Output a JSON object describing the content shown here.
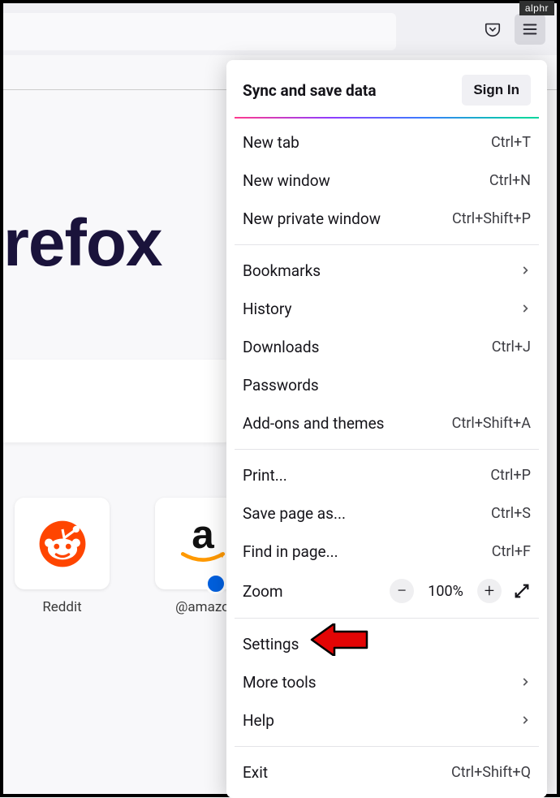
{
  "watermark": "alphr",
  "brand_text": "refox",
  "tiles": [
    {
      "label": "Reddit"
    },
    {
      "label": "@amazo"
    }
  ],
  "menu": {
    "header_title": "Sync and save data",
    "signin_label": "Sign In",
    "section1": [
      {
        "label": "New tab",
        "shortcut": "Ctrl+T"
      },
      {
        "label": "New window",
        "shortcut": "Ctrl+N"
      },
      {
        "label": "New private window",
        "shortcut": "Ctrl+Shift+P"
      }
    ],
    "section2": [
      {
        "label": "Bookmarks",
        "chevron": true
      },
      {
        "label": "History",
        "chevron": true
      },
      {
        "label": "Downloads",
        "shortcut": "Ctrl+J"
      },
      {
        "label": "Passwords"
      },
      {
        "label": "Add-ons and themes",
        "shortcut": "Ctrl+Shift+A"
      }
    ],
    "section3": [
      {
        "label": "Print...",
        "shortcut": "Ctrl+P"
      },
      {
        "label": "Save page as...",
        "shortcut": "Ctrl+S"
      },
      {
        "label": "Find in page...",
        "shortcut": "Ctrl+F"
      }
    ],
    "zoom_label": "Zoom",
    "zoom_value": "100%",
    "section4": [
      {
        "label": "Settings"
      },
      {
        "label": "More tools",
        "chevron": true
      },
      {
        "label": "Help",
        "chevron": true
      }
    ],
    "section5": [
      {
        "label": "Exit",
        "shortcut": "Ctrl+Shift+Q"
      }
    ]
  }
}
